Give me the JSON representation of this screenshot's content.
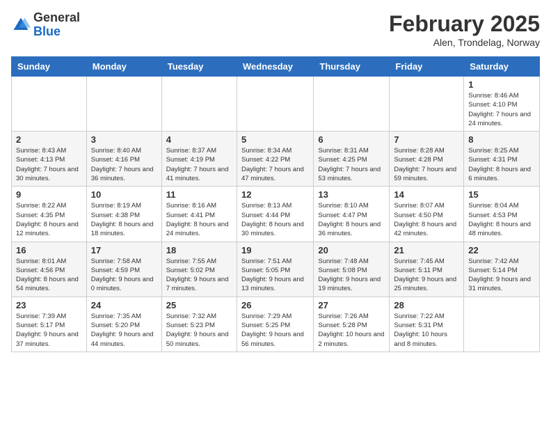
{
  "header": {
    "logo_general": "General",
    "logo_blue": "Blue",
    "title": "February 2025",
    "location": "Alen, Trondelag, Norway"
  },
  "days_of_week": [
    "Sunday",
    "Monday",
    "Tuesday",
    "Wednesday",
    "Thursday",
    "Friday",
    "Saturday"
  ],
  "weeks": [
    [
      {
        "day": "",
        "info": ""
      },
      {
        "day": "",
        "info": ""
      },
      {
        "day": "",
        "info": ""
      },
      {
        "day": "",
        "info": ""
      },
      {
        "day": "",
        "info": ""
      },
      {
        "day": "",
        "info": ""
      },
      {
        "day": "1",
        "info": "Sunrise: 8:46 AM\nSunset: 4:10 PM\nDaylight: 7 hours and 24 minutes."
      }
    ],
    [
      {
        "day": "2",
        "info": "Sunrise: 8:43 AM\nSunset: 4:13 PM\nDaylight: 7 hours and 30 minutes."
      },
      {
        "day": "3",
        "info": "Sunrise: 8:40 AM\nSunset: 4:16 PM\nDaylight: 7 hours and 36 minutes."
      },
      {
        "day": "4",
        "info": "Sunrise: 8:37 AM\nSunset: 4:19 PM\nDaylight: 7 hours and 41 minutes."
      },
      {
        "day": "5",
        "info": "Sunrise: 8:34 AM\nSunset: 4:22 PM\nDaylight: 7 hours and 47 minutes."
      },
      {
        "day": "6",
        "info": "Sunrise: 8:31 AM\nSunset: 4:25 PM\nDaylight: 7 hours and 53 minutes."
      },
      {
        "day": "7",
        "info": "Sunrise: 8:28 AM\nSunset: 4:28 PM\nDaylight: 7 hours and 59 minutes."
      },
      {
        "day": "8",
        "info": "Sunrise: 8:25 AM\nSunset: 4:31 PM\nDaylight: 8 hours and 6 minutes."
      }
    ],
    [
      {
        "day": "9",
        "info": "Sunrise: 8:22 AM\nSunset: 4:35 PM\nDaylight: 8 hours and 12 minutes."
      },
      {
        "day": "10",
        "info": "Sunrise: 8:19 AM\nSunset: 4:38 PM\nDaylight: 8 hours and 18 minutes."
      },
      {
        "day": "11",
        "info": "Sunrise: 8:16 AM\nSunset: 4:41 PM\nDaylight: 8 hours and 24 minutes."
      },
      {
        "day": "12",
        "info": "Sunrise: 8:13 AM\nSunset: 4:44 PM\nDaylight: 8 hours and 30 minutes."
      },
      {
        "day": "13",
        "info": "Sunrise: 8:10 AM\nSunset: 4:47 PM\nDaylight: 8 hours and 36 minutes."
      },
      {
        "day": "14",
        "info": "Sunrise: 8:07 AM\nSunset: 4:50 PM\nDaylight: 8 hours and 42 minutes."
      },
      {
        "day": "15",
        "info": "Sunrise: 8:04 AM\nSunset: 4:53 PM\nDaylight: 8 hours and 48 minutes."
      }
    ],
    [
      {
        "day": "16",
        "info": "Sunrise: 8:01 AM\nSunset: 4:56 PM\nDaylight: 8 hours and 54 minutes."
      },
      {
        "day": "17",
        "info": "Sunrise: 7:58 AM\nSunset: 4:59 PM\nDaylight: 9 hours and 0 minutes."
      },
      {
        "day": "18",
        "info": "Sunrise: 7:55 AM\nSunset: 5:02 PM\nDaylight: 9 hours and 7 minutes."
      },
      {
        "day": "19",
        "info": "Sunrise: 7:51 AM\nSunset: 5:05 PM\nDaylight: 9 hours and 13 minutes."
      },
      {
        "day": "20",
        "info": "Sunrise: 7:48 AM\nSunset: 5:08 PM\nDaylight: 9 hours and 19 minutes."
      },
      {
        "day": "21",
        "info": "Sunrise: 7:45 AM\nSunset: 5:11 PM\nDaylight: 9 hours and 25 minutes."
      },
      {
        "day": "22",
        "info": "Sunrise: 7:42 AM\nSunset: 5:14 PM\nDaylight: 9 hours and 31 minutes."
      }
    ],
    [
      {
        "day": "23",
        "info": "Sunrise: 7:39 AM\nSunset: 5:17 PM\nDaylight: 9 hours and 37 minutes."
      },
      {
        "day": "24",
        "info": "Sunrise: 7:35 AM\nSunset: 5:20 PM\nDaylight: 9 hours and 44 minutes."
      },
      {
        "day": "25",
        "info": "Sunrise: 7:32 AM\nSunset: 5:23 PM\nDaylight: 9 hours and 50 minutes."
      },
      {
        "day": "26",
        "info": "Sunrise: 7:29 AM\nSunset: 5:25 PM\nDaylight: 9 hours and 56 minutes."
      },
      {
        "day": "27",
        "info": "Sunrise: 7:26 AM\nSunset: 5:28 PM\nDaylight: 10 hours and 2 minutes."
      },
      {
        "day": "28",
        "info": "Sunrise: 7:22 AM\nSunset: 5:31 PM\nDaylight: 10 hours and 8 minutes."
      },
      {
        "day": "",
        "info": ""
      }
    ]
  ]
}
